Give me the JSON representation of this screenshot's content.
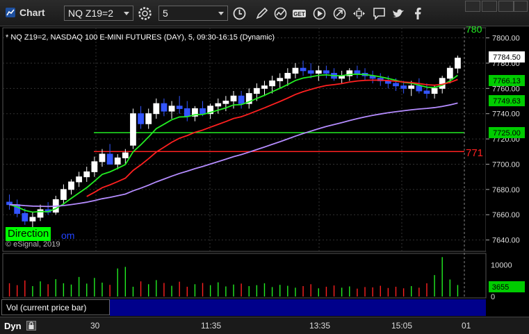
{
  "window": {
    "title": "Chart"
  },
  "toolbar": {
    "symbol_value": "NQ Z19=2",
    "interval_value": "5",
    "icons": [
      "gear-icon",
      "clock-icon",
      "pencil-icon",
      "studies-icon",
      "get-icon",
      "play-icon",
      "link-icon",
      "move-icon",
      "comment-icon",
      "twitter-icon",
      "facebook-icon"
    ]
  },
  "chart": {
    "info_line": "* NQ Z19=2, NASDAQ 100 E-MINI FUTURES (DAY), 5, 09:30-16:15 (Dynamic)",
    "copyright": "© eSignal, 2019",
    "watermark_label": "Direction",
    "watermark_suffix": "om",
    "price_labels": {
      "last": "7784.50",
      "green_ma": "7766.13",
      "purple_ma": "7749.63",
      "green_level": "7725.00",
      "red_level_partial": "771",
      "top_partial": "780"
    }
  },
  "volume": {
    "label": "Vol (current price bar)",
    "last_value": "3655",
    "ticks": [
      "10000",
      "0"
    ]
  },
  "bottom": {
    "mode": "Dyn",
    "xticks": [
      "30",
      "11:35",
      "13:35",
      "15:05",
      "01"
    ]
  },
  "chart_data": {
    "type": "candlestick",
    "title": "NQ Z19=2, NASDAQ 100 E-MINI FUTURES (DAY), 5, 09:30-16:15 (Dynamic)",
    "y_ticks": [
      7640,
      7660,
      7680,
      7700,
      7720,
      7740,
      7760,
      7780,
      7800
    ],
    "ylim": [
      7631,
      7808
    ],
    "x_ticks": [
      "30",
      "11:35",
      "13:35",
      "15:05",
      "01"
    ],
    "candles": [
      [
        7670,
        7676,
        7664,
        7668
      ],
      [
        7668,
        7672,
        7658,
        7661
      ],
      [
        7661,
        7665,
        7652,
        7655
      ],
      [
        7655,
        7662,
        7650,
        7658
      ],
      [
        7658,
        7668,
        7655,
        7664
      ],
      [
        7664,
        7670,
        7660,
        7662
      ],
      [
        7662,
        7675,
        7660,
        7672
      ],
      [
        7672,
        7684,
        7668,
        7680
      ],
      [
        7680,
        7688,
        7676,
        7686
      ],
      [
        7686,
        7694,
        7682,
        7690
      ],
      [
        7690,
        7698,
        7686,
        7694
      ],
      [
        7694,
        7706,
        7690,
        7702
      ],
      [
        7702,
        7712,
        7698,
        7708
      ],
      [
        7708,
        7716,
        7704,
        7700
      ],
      [
        7700,
        7708,
        7696,
        7705
      ],
      [
        7705,
        7712,
        7700,
        7709
      ],
      [
        7715,
        7744,
        7712,
        7740
      ],
      [
        7740,
        7746,
        7728,
        7732
      ],
      [
        7732,
        7744,
        7728,
        7740
      ],
      [
        7740,
        7752,
        7736,
        7748
      ],
      [
        7748,
        7752,
        7738,
        7742
      ],
      [
        7742,
        7750,
        7736,
        7746
      ],
      [
        7746,
        7754,
        7740,
        7744
      ],
      [
        7744,
        7750,
        7734,
        7738
      ],
      [
        7738,
        7746,
        7734,
        7744
      ],
      [
        7744,
        7750,
        7738,
        7740
      ],
      [
        7740,
        7748,
        7736,
        7746
      ],
      [
        7746,
        7752,
        7740,
        7748
      ],
      [
        7748,
        7754,
        7742,
        7750
      ],
      [
        7750,
        7758,
        7744,
        7754
      ],
      [
        7754,
        7758,
        7744,
        7748
      ],
      [
        7748,
        7760,
        7744,
        7756
      ],
      [
        7756,
        7764,
        7750,
        7760
      ],
      [
        7760,
        7766,
        7754,
        7762
      ],
      [
        7762,
        7770,
        7756,
        7766
      ],
      [
        7766,
        7772,
        7760,
        7768
      ],
      [
        7768,
        7776,
        7762,
        7772
      ],
      [
        7772,
        7780,
        7768,
        7776
      ],
      [
        7776,
        7782,
        7770,
        7774
      ],
      [
        7774,
        7780,
        7768,
        7772
      ],
      [
        7772,
        7778,
        7766,
        7774
      ],
      [
        7774,
        7778,
        7768,
        7772
      ],
      [
        7772,
        7776,
        7766,
        7768
      ],
      [
        7768,
        7774,
        7764,
        7770
      ],
      [
        7770,
        7776,
        7766,
        7774
      ],
      [
        7774,
        7778,
        7768,
        7772
      ],
      [
        7772,
        7776,
        7766,
        7770
      ],
      [
        7770,
        7774,
        7764,
        7768
      ],
      [
        7768,
        7772,
        7762,
        7766
      ],
      [
        7766,
        7770,
        7760,
        7764
      ],
      [
        7764,
        7768,
        7758,
        7762
      ],
      [
        7762,
        7766,
        7756,
        7760
      ],
      [
        7760,
        7766,
        7754,
        7762
      ],
      [
        7762,
        7768,
        7756,
        7758
      ],
      [
        7758,
        7764,
        7752,
        7756
      ],
      [
        7756,
        7762,
        7752,
        7760
      ],
      [
        7760,
        7770,
        7756,
        7768
      ],
      [
        7768,
        7778,
        7764,
        7776
      ],
      [
        7776,
        7786,
        7772,
        7784
      ]
    ],
    "series": [
      {
        "name": "",
        "color": "#ff2020",
        "type": "line"
      },
      {
        "name": "",
        "color": "#22ee22",
        "type": "line"
      },
      {
        "name": "",
        "color": "#b58cff",
        "type": "line"
      }
    ],
    "levels": [
      {
        "value": 7725,
        "color": "#22ee22"
      },
      {
        "value": 7710,
        "color": "#ff2020"
      }
    ],
    "volume": [
      4200,
      3600,
      5100,
      3300,
      4800,
      3900,
      5500,
      4200,
      3800,
      6200,
      4100,
      5900,
      4400,
      3700,
      8900,
      9400,
      3100,
      4800,
      3900,
      5200,
      4300,
      3400,
      4700,
      3100,
      3900,
      4300,
      3600,
      4500,
      3200,
      3800,
      4100,
      3300,
      3600,
      4200,
      3000,
      3700,
      3400,
      2800,
      3300,
      3900,
      2600,
      3100,
      3500,
      2800,
      3200,
      2500,
      3000,
      2900,
      3400,
      2700,
      3100,
      2600,
      3300,
      2800,
      4200,
      6800,
      12500,
      5400,
      3655
    ],
    "volume_ylim": [
      0,
      13000
    ]
  }
}
